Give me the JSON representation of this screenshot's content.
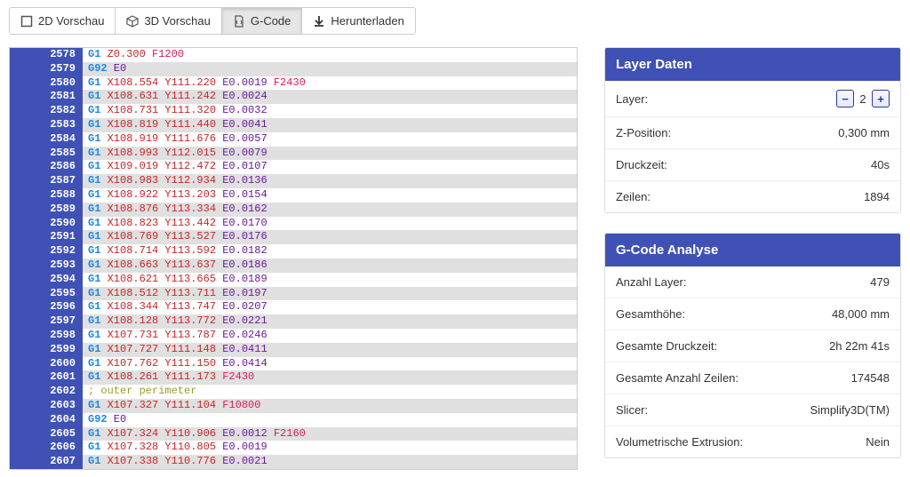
{
  "tabs": {
    "t0": "2D Vorschau",
    "t1": "3D Vorschau",
    "t2": "G-Code",
    "t3": "Herunterladen"
  },
  "layer_panel": {
    "title": "Layer Daten",
    "layer_label": "Layer:",
    "layer_value": "2",
    "zpos_label": "Z-Position:",
    "zpos_value": "0,300 mm",
    "time_label": "Druckzeit:",
    "time_value": "40s",
    "lines_label": "Zeilen:",
    "lines_value": "1894"
  },
  "analyse_panel": {
    "title": "G-Code Analyse",
    "layers_label": "Anzahl Layer:",
    "layers_value": "479",
    "height_label": "Gesamthöhe:",
    "height_value": "48,000 mm",
    "time_label": "Gesamte Druckzeit:",
    "time_value": "2h 22m 41s",
    "lines_label": "Gesamte Anzahl Zeilen:",
    "lines_value": "174548",
    "slicer_label": "Slicer:",
    "slicer_value": "Simplify3D(TM)",
    "volext_label": "Volumetrische Extrusion:",
    "volext_value": "Nein"
  },
  "code": [
    {
      "n": "2578",
      "t": [
        [
          "cmd",
          "G1"
        ],
        [
          "coord",
          " Z0.300"
        ],
        [
          "f",
          " F1200"
        ]
      ]
    },
    {
      "n": "2579",
      "t": [
        [
          "cmd",
          "G92"
        ],
        [
          "e",
          " E0"
        ]
      ]
    },
    {
      "n": "2580",
      "t": [
        [
          "cmd",
          "G1"
        ],
        [
          "coord",
          " X108.554 Y111.220"
        ],
        [
          "e",
          " E0.0019"
        ],
        [
          "f",
          " F2430"
        ]
      ]
    },
    {
      "n": "2581",
      "t": [
        [
          "cmd",
          "G1"
        ],
        [
          "coord",
          " X108.631 Y111.242"
        ],
        [
          "e",
          " E0.0024"
        ]
      ]
    },
    {
      "n": "2582",
      "t": [
        [
          "cmd",
          "G1"
        ],
        [
          "coord",
          " X108.731 Y111.320"
        ],
        [
          "e",
          " E0.0032"
        ]
      ]
    },
    {
      "n": "2583",
      "t": [
        [
          "cmd",
          "G1"
        ],
        [
          "coord",
          " X108.819 Y111.440"
        ],
        [
          "e",
          " E0.0041"
        ]
      ]
    },
    {
      "n": "2584",
      "t": [
        [
          "cmd",
          "G1"
        ],
        [
          "coord",
          " X108.919 Y111.676"
        ],
        [
          "e",
          " E0.0057"
        ]
      ]
    },
    {
      "n": "2585",
      "t": [
        [
          "cmd",
          "G1"
        ],
        [
          "coord",
          " X108.993 Y112.015"
        ],
        [
          "e",
          " E0.0079"
        ]
      ]
    },
    {
      "n": "2586",
      "t": [
        [
          "cmd",
          "G1"
        ],
        [
          "coord",
          " X109.019 Y112.472"
        ],
        [
          "e",
          " E0.0107"
        ]
      ]
    },
    {
      "n": "2587",
      "t": [
        [
          "cmd",
          "G1"
        ],
        [
          "coord",
          " X108.983 Y112.934"
        ],
        [
          "e",
          " E0.0136"
        ]
      ]
    },
    {
      "n": "2588",
      "t": [
        [
          "cmd",
          "G1"
        ],
        [
          "coord",
          " X108.922 Y113.203"
        ],
        [
          "e",
          " E0.0154"
        ]
      ]
    },
    {
      "n": "2589",
      "t": [
        [
          "cmd",
          "G1"
        ],
        [
          "coord",
          " X108.876 Y113.334"
        ],
        [
          "e",
          " E0.0162"
        ]
      ]
    },
    {
      "n": "2590",
      "t": [
        [
          "cmd",
          "G1"
        ],
        [
          "coord",
          " X108.823 Y113.442"
        ],
        [
          "e",
          " E0.0170"
        ]
      ]
    },
    {
      "n": "2591",
      "t": [
        [
          "cmd",
          "G1"
        ],
        [
          "coord",
          " X108.769 Y113.527"
        ],
        [
          "e",
          " E0.0176"
        ]
      ]
    },
    {
      "n": "2592",
      "t": [
        [
          "cmd",
          "G1"
        ],
        [
          "coord",
          " X108.714 Y113.592"
        ],
        [
          "e",
          " E0.0182"
        ]
      ]
    },
    {
      "n": "2593",
      "t": [
        [
          "cmd",
          "G1"
        ],
        [
          "coord",
          " X108.663 Y113.637"
        ],
        [
          "e",
          " E0.0186"
        ]
      ]
    },
    {
      "n": "2594",
      "t": [
        [
          "cmd",
          "G1"
        ],
        [
          "coord",
          " X108.621 Y113.665"
        ],
        [
          "e",
          " E0.0189"
        ]
      ]
    },
    {
      "n": "2595",
      "t": [
        [
          "cmd",
          "G1"
        ],
        [
          "coord",
          " X108.512 Y113.711"
        ],
        [
          "e",
          " E0.0197"
        ]
      ]
    },
    {
      "n": "2596",
      "t": [
        [
          "cmd",
          "G1"
        ],
        [
          "coord",
          " X108.344 Y113.747"
        ],
        [
          "e",
          " E0.0207"
        ]
      ]
    },
    {
      "n": "2597",
      "t": [
        [
          "cmd",
          "G1"
        ],
        [
          "coord",
          " X108.128 Y113.772"
        ],
        [
          "e",
          " E0.0221"
        ]
      ]
    },
    {
      "n": "2598",
      "t": [
        [
          "cmd",
          "G1"
        ],
        [
          "coord",
          " X107.731 Y113.787"
        ],
        [
          "e",
          " E0.0246"
        ]
      ]
    },
    {
      "n": "2599",
      "t": [
        [
          "cmd",
          "G1"
        ],
        [
          "coord",
          " X107.727 Y111.148"
        ],
        [
          "e",
          " E0.0411"
        ]
      ]
    },
    {
      "n": "2600",
      "t": [
        [
          "cmd",
          "G1"
        ],
        [
          "coord",
          " X107.762 Y111.150"
        ],
        [
          "e",
          " E0.0414"
        ]
      ]
    },
    {
      "n": "2601",
      "t": [
        [
          "cmd",
          "G1"
        ],
        [
          "coord",
          " X108.261 Y111.173"
        ],
        [
          "f",
          " F2430"
        ]
      ]
    },
    {
      "n": "2602",
      "t": [
        [
          "comment",
          "; outer perimeter"
        ]
      ]
    },
    {
      "n": "2603",
      "t": [
        [
          "cmd",
          "G1"
        ],
        [
          "coord",
          " X107.327 Y111.104"
        ],
        [
          "f",
          " F10800"
        ]
      ]
    },
    {
      "n": "2604",
      "t": [
        [
          "cmd",
          "G92"
        ],
        [
          "e",
          " E0"
        ]
      ]
    },
    {
      "n": "2605",
      "t": [
        [
          "cmd",
          "G1"
        ],
        [
          "coord",
          " X107.324 Y110.906"
        ],
        [
          "e",
          " E0.0012"
        ],
        [
          "f",
          " F2160"
        ]
      ]
    },
    {
      "n": "2606",
      "t": [
        [
          "cmd",
          "G1"
        ],
        [
          "coord",
          " X107.328 Y110.805"
        ],
        [
          "e",
          " E0.0019"
        ]
      ]
    },
    {
      "n": "2607",
      "t": [
        [
          "cmd",
          "G1"
        ],
        [
          "coord",
          " X107.338 Y110.776"
        ],
        [
          "e",
          " E0.0021"
        ]
      ]
    }
  ]
}
